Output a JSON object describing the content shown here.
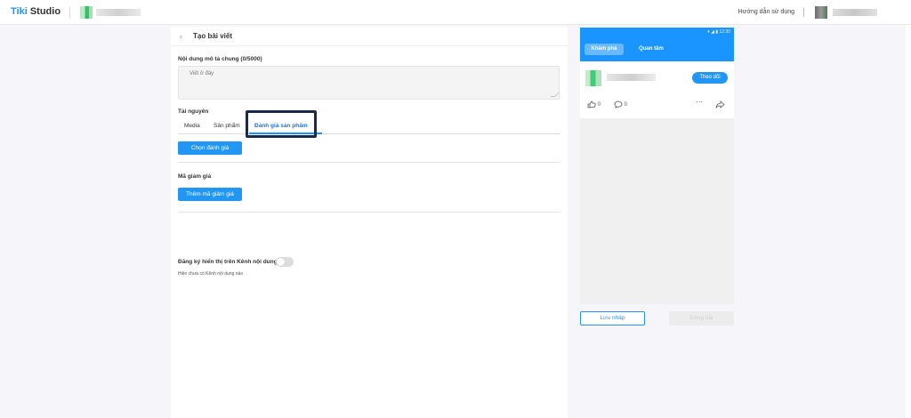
{
  "topbar": {
    "brand_primary": "Tiki",
    "brand_secondary": "Studio",
    "guide_link": "Hướng dẫn sử dụng",
    "separator": "|"
  },
  "post_form": {
    "back_icon": "‹",
    "title": "Tạo bài viết",
    "description": {
      "label": "Nội dung mô tả chung (0/5000)",
      "placeholder": "Viết ở đây",
      "value": ""
    },
    "resources": {
      "label": "Tài nguyên",
      "tabs": [
        {
          "label": "Media"
        },
        {
          "label": "Sản phẩm"
        },
        {
          "label": "Đánh giá sản phẩm",
          "active": true
        }
      ],
      "choose_review_button": "Chọn đánh giá"
    },
    "coupon": {
      "label": "Mã giảm giá",
      "add_button": "Thêm mã giảm giá"
    },
    "register": {
      "label": "Đăng ký hiển thị trên Kênh nội dung",
      "toggle_on": false,
      "note": "Hiện chưa có Kênh nội dung nào"
    }
  },
  "preview": {
    "status_time": "12:30",
    "tabs": [
      {
        "label": "Khám phá",
        "active": true
      },
      {
        "label": "Quan tâm"
      }
    ],
    "follow_button": "Theo dõi",
    "like_count": "0",
    "comment_count": "0",
    "more_icon": "···",
    "share_icon": "share-icon"
  },
  "actions": {
    "save_draft": "Lưu nháp",
    "publish": "Đăng bài"
  },
  "colors": {
    "accent": "#1a94ff",
    "button_blue": "#2196f3",
    "highlight_frame": "#1b2a4a"
  }
}
